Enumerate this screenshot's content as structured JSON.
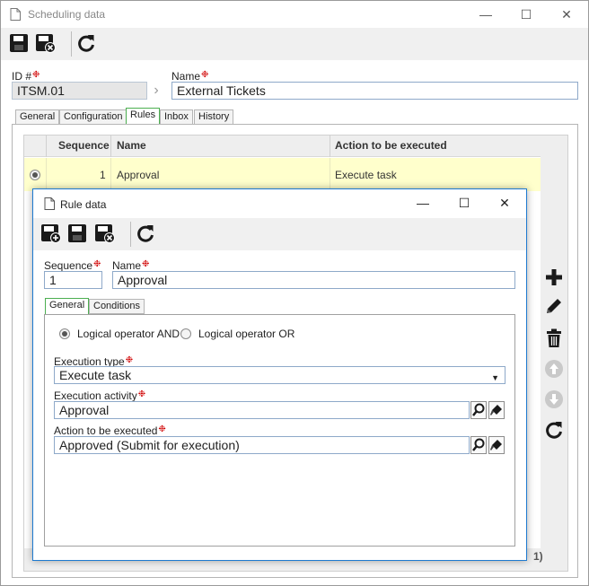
{
  "main_window": {
    "title": "Scheduling data",
    "controls": {
      "minimize": "—",
      "maximize": "☐",
      "close": "✕"
    },
    "toolbar": [
      {
        "icon": "save-icon"
      },
      {
        "icon": "save-close-icon"
      },
      {
        "icon": "refresh-icon"
      }
    ],
    "id_label": "ID #",
    "id_value": "ITSM.01",
    "name_label": "Name",
    "name_value": "External Tickets",
    "tabs": [
      {
        "label": "General",
        "active": false
      },
      {
        "label": "Configuration",
        "active": false
      },
      {
        "label": "Rules",
        "active": true
      },
      {
        "label": "Inbox",
        "active": false
      },
      {
        "label": "History",
        "active": false
      }
    ],
    "grid": {
      "columns": [
        "Sequence",
        "Name",
        "Action to be executed"
      ],
      "rows": [
        {
          "sequence": "1",
          "name": "Approval",
          "action": "Execute task",
          "selected": true
        }
      ]
    },
    "side_buttons": [
      "add-icon",
      "edit-icon",
      "delete-icon",
      "move-up-icon",
      "move-down-icon",
      "refresh-icon"
    ],
    "partial_text_bottom": "1)"
  },
  "dialog": {
    "title": "Rule data",
    "controls": {
      "minimize": "—",
      "maximize": "☐",
      "close": "✕"
    },
    "toolbar": [
      {
        "icon": "save-new-icon"
      },
      {
        "icon": "save-icon"
      },
      {
        "icon": "save-close-icon"
      },
      {
        "icon": "refresh-icon"
      }
    ],
    "sequence_label": "Sequence",
    "sequence_value": "1",
    "name_label": "Name",
    "name_value": "Approval",
    "tabs": [
      {
        "label": "General",
        "active": true
      },
      {
        "label": "Conditions",
        "active": false
      }
    ],
    "logical_and": "Logical operator AND",
    "logical_or": "Logical operator OR",
    "logical_selected": "AND",
    "execution_type_label": "Execution type",
    "execution_type_value": "Execute task",
    "execution_activity_label": "Execution activity",
    "execution_activity_value": "Approval",
    "action_label": "Action to be executed",
    "action_value": "Approved (Submit for execution)"
  },
  "colors": {
    "accent_blue": "#1e7ad0",
    "required_red": "#d00000",
    "selected_row": "#ffffcc",
    "tab_active_border": "#4caf50"
  }
}
